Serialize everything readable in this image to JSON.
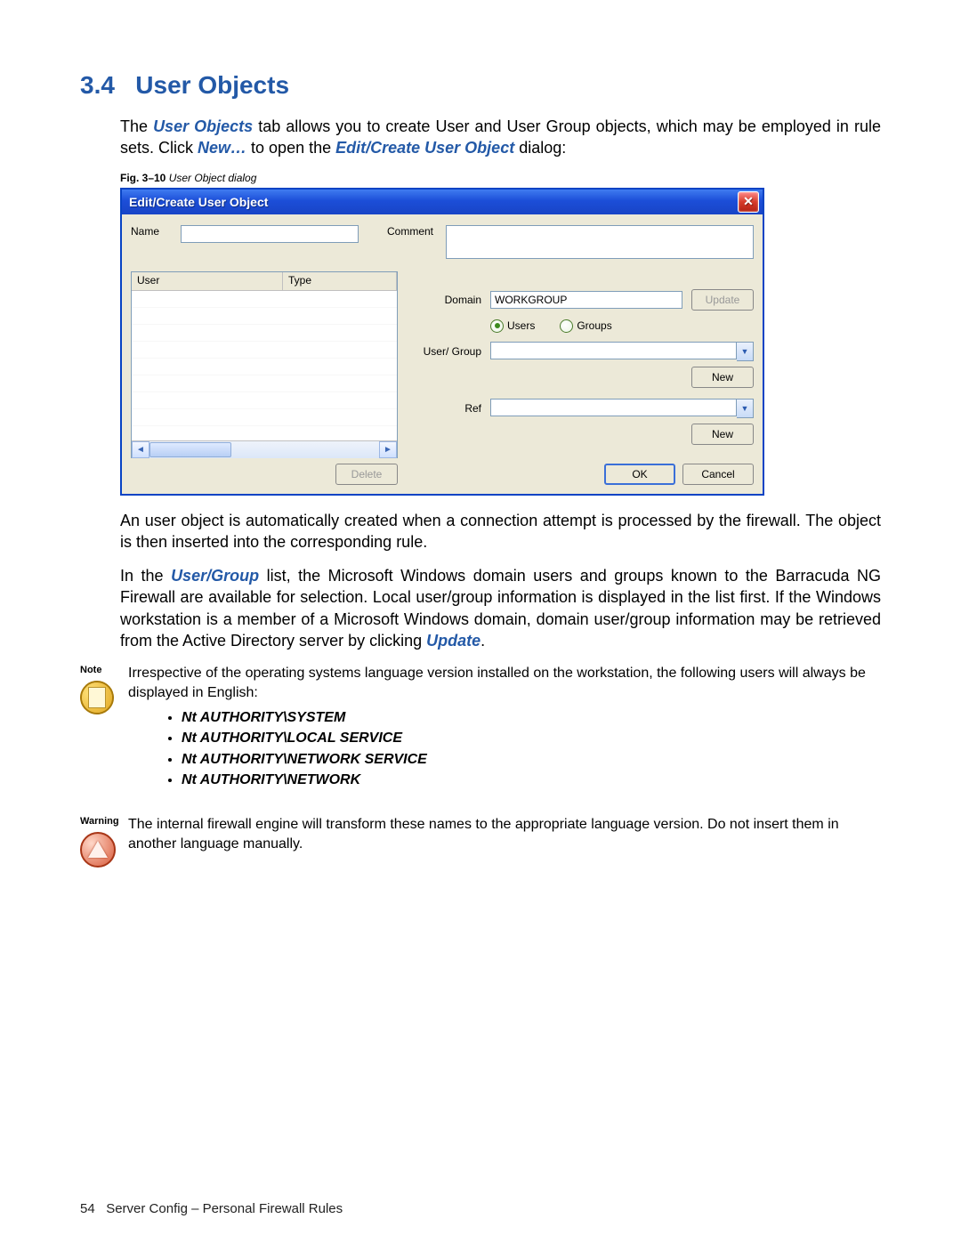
{
  "section": {
    "number": "3.4",
    "title": "User Objects"
  },
  "para1_a": "The ",
  "para1_kw1": "User Objects",
  "para1_b": " tab allows you to create User and User Group objects, which may be employed in rule sets. Click ",
  "para1_kw2": "New…",
  "para1_c": " to open the ",
  "para1_kw3": "Edit/Create User Object",
  "para1_d": " dialog:",
  "fig_caption_bold": "Fig. 3–10",
  "fig_caption_italic": " User Object dialog",
  "dialog": {
    "title": "Edit/Create User Object",
    "name_label": "Name",
    "name_value": "",
    "comment_label": "Comment",
    "comment_value": "",
    "list_col1": "User",
    "list_col2": "Type",
    "delete_btn": "Delete",
    "domain_label": "Domain",
    "domain_value": "WORKGROUP",
    "update_btn": "Update",
    "radio_users": "Users",
    "radio_groups": "Groups",
    "radio_selected": "users",
    "usergroup_label": "User/ Group",
    "usergroup_value": "",
    "new_btn1": "New",
    "ref_label": "Ref",
    "ref_value": "",
    "new_btn2": "New",
    "ok_btn": "OK",
    "cancel_btn": "Cancel"
  },
  "para2": "An user object is automatically created when a connection attempt is processed by the firewall. The object is then inserted into the corresponding rule.",
  "para3_a": "In the ",
  "para3_kw1": "User/Group",
  "para3_b": " list, the Microsoft Windows domain users and groups known to the Barracuda NG Firewall are available for selection. Local user/group information is displayed in the list first. If the Windows workstation is a member of a Microsoft Windows domain, domain user/group information may be retrieved from the Active Directory server by clicking ",
  "para3_kw2": "Update",
  "para3_c": ".",
  "note": {
    "tag": "Note",
    "text": "Irrespective of the operating systems language version installed on the workstation, the following users will always be displayed in English:",
    "items": [
      "Nt AUTHORITY\\SYSTEM",
      "Nt AUTHORITY\\LOCAL SERVICE",
      "Nt AUTHORITY\\NETWORK SERVICE",
      "Nt AUTHORITY\\NETWORK"
    ]
  },
  "warning": {
    "tag": "Warning",
    "text": "The internal firewall engine will transform these names to the appropriate language version. Do not insert them in another language manually."
  },
  "footer": {
    "page": "54",
    "text": "Server Config – Personal Firewall Rules"
  }
}
